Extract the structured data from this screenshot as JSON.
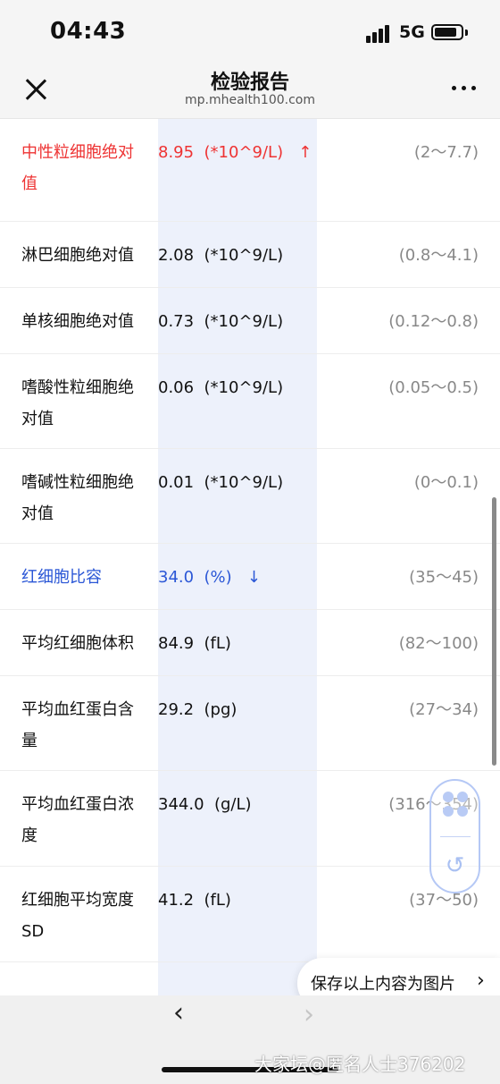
{
  "status_bar": {
    "time": "04:43",
    "network": "5G"
  },
  "nav": {
    "title": "检验报告",
    "subtitle": "mp.mhealth100.com"
  },
  "rows": [
    {
      "name": "中性粒细胞绝对值",
      "value": "8.95  (*10^9/L)   ↑",
      "range": "(2～7.7)",
      "flag": "high"
    },
    {
      "name": "淋巴细胞绝对值",
      "value": "2.08  (*10^9/L)",
      "range": "(0.8～4.1)",
      "flag": "normal"
    },
    {
      "name": "单核细胞绝对值",
      "value": "0.73  (*10^9/L)",
      "range": "(0.12～0.8)",
      "flag": "normal"
    },
    {
      "name": "嗜酸性粒细胞绝对值",
      "value": "0.06  (*10^9/L)",
      "range": "(0.05～0.5)",
      "flag": "normal"
    },
    {
      "name": "嗜碱性粒细胞绝对值",
      "value": "0.01  (*10^9/L)",
      "range": "(0～0.1)",
      "flag": "normal"
    },
    {
      "name": "红细胞比容",
      "value": "34.0  (%)   ↓",
      "range": "(35～45)",
      "flag": "low"
    },
    {
      "name": "平均红细胞体积",
      "value": "84.9  (fL)",
      "range": "(82～100)",
      "flag": "normal"
    },
    {
      "name": "平均血红蛋白含量",
      "value": "29.2  (pg)",
      "range": "(27～34)",
      "flag": "normal"
    },
    {
      "name": "平均血红蛋白浓度",
      "value": "344.0  (g/L)",
      "range": "(316～354)",
      "flag": "normal"
    },
    {
      "name": "红细胞平均宽度SD",
      "value": "41.2  (fL)",
      "range": "(37～50)",
      "flag": "normal"
    }
  ],
  "save_button": {
    "label": "保存以上内容为图片",
    "chevron": "›"
  },
  "bottom_nav": {
    "back": "‹",
    "forward": "›"
  },
  "watermark": "大家坛@匿名人士376202",
  "colors": {
    "high": "#ee3333",
    "low": "#2b57d6",
    "range": "#888888",
    "highlight_column": "#edf1fb"
  }
}
